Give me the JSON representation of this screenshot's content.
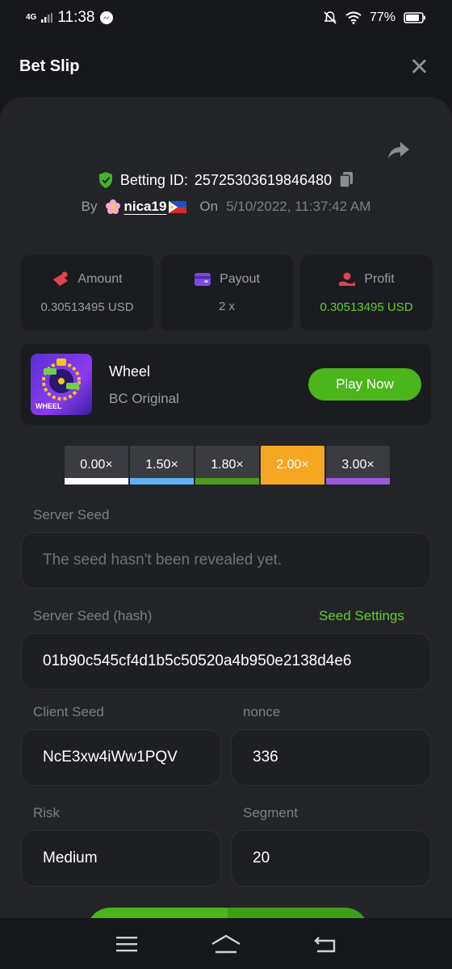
{
  "status_bar": {
    "network": "4G",
    "time": "11:38",
    "battery": "77%"
  },
  "header": {
    "title": "Bet Slip"
  },
  "bet": {
    "betting_id_label": "Betting ID:",
    "betting_id": "25725303619846480",
    "by_label": "By",
    "user": "nica19",
    "on_label": "On",
    "date": "5/10/2022, 11:37:42 AM"
  },
  "stats": [
    {
      "label": "Amount",
      "value": "0.30513495 USD",
      "icon": "amount-icon"
    },
    {
      "label": "Payout",
      "value": "2 x",
      "icon": "wallet-icon"
    },
    {
      "label": "Profit",
      "value": "0.30513495 USD",
      "icon": "profit-icon"
    }
  ],
  "game": {
    "name": "Wheel",
    "subtitle": "BC Original",
    "play_label": "Play Now",
    "thumb_label": "WHEEL"
  },
  "multipliers": [
    {
      "label": "0.00×",
      "color": "#ffffff",
      "active": false
    },
    {
      "label": "1.50×",
      "color": "#5fb2f0",
      "active": false
    },
    {
      "label": "1.80×",
      "color": "#4e9a1e",
      "active": false
    },
    {
      "label": "2.00×",
      "color": "#f5a623",
      "active": true
    },
    {
      "label": "3.00×",
      "color": "#9b59e0",
      "active": false
    }
  ],
  "server_seed": {
    "label": "Server Seed",
    "value": "The seed hasn't been revealed yet."
  },
  "server_seed_hash": {
    "label": "Server Seed (hash)",
    "link": "Seed Settings",
    "value": "01b90c545cf4d1b5c50520a4b950e2138d4e6"
  },
  "client_seed": {
    "label": "Client Seed",
    "value": "NcE3xw4iWw1PQV"
  },
  "nonce": {
    "label": "nonce",
    "value": "336"
  },
  "risk": {
    "label": "Risk",
    "value": "Medium"
  },
  "segment": {
    "label": "Segment",
    "value": "20"
  },
  "colors": {
    "accent_green": "#4bb51c",
    "active_orange": "#f5a623",
    "background": "#17181b",
    "panel": "#232427"
  }
}
